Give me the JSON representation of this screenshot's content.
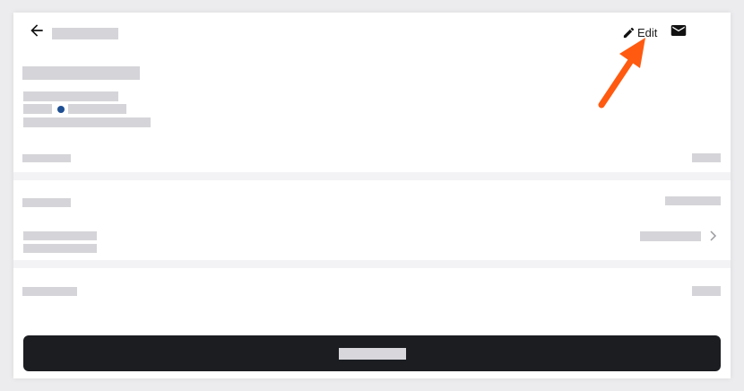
{
  "header": {
    "edit_label": "Edit",
    "back_icon": "arrow-left-icon",
    "edit_icon": "pencil-icon",
    "mail_icon": "envelope-icon"
  },
  "colors": {
    "accent_arrow": "#ff5a10",
    "primary_button": "#1b1d21",
    "placeholder": "#d5d5d9",
    "status_dot": "#1e4f93"
  }
}
